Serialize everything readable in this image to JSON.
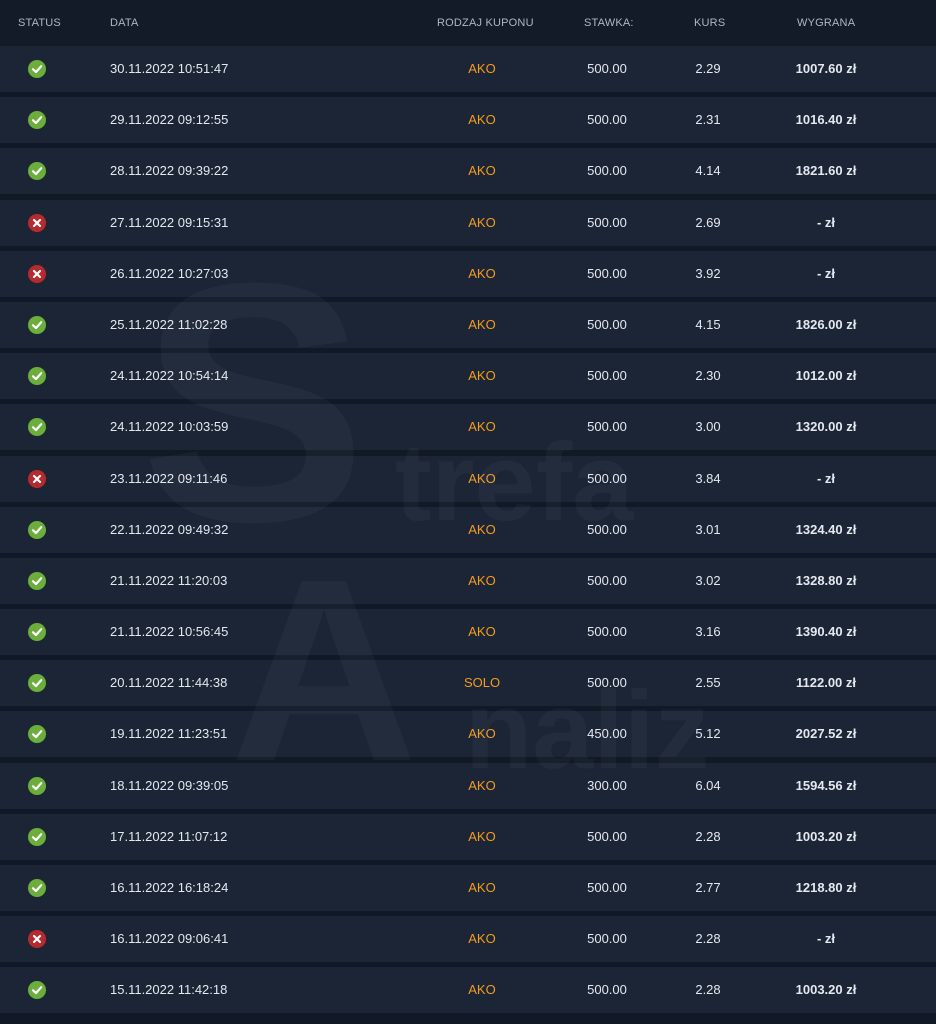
{
  "header": {
    "status": "STATUS",
    "date": "DATA",
    "coupon_type": "RODZAJ KUPONU",
    "stake": "STAWKA:",
    "odds": "KURS",
    "win": "WYGRANA"
  },
  "colors": {
    "won": "#6cae3b",
    "lost": "#b52a2e",
    "coupon_type": "#f59b1d",
    "row_bg": "#1b2536",
    "page_bg": "#111826"
  },
  "rows": [
    {
      "status": "won",
      "status_icon": "check-circle-icon",
      "date": "30.11.2022 10:51:47",
      "type": "AKO",
      "stake": "500.00",
      "odds": "2.29",
      "win": "1007.60 zł"
    },
    {
      "status": "won",
      "status_icon": "check-circle-icon",
      "date": "29.11.2022 09:12:55",
      "type": "AKO",
      "stake": "500.00",
      "odds": "2.31",
      "win": "1016.40 zł"
    },
    {
      "status": "won",
      "status_icon": "check-circle-icon",
      "date": "28.11.2022 09:39:22",
      "type": "AKO",
      "stake": "500.00",
      "odds": "4.14",
      "win": "1821.60 zł"
    },
    {
      "status": "lost",
      "status_icon": "x-circle-icon",
      "date": "27.11.2022 09:15:31",
      "type": "AKO",
      "stake": "500.00",
      "odds": "2.69",
      "win": "- zł"
    },
    {
      "status": "lost",
      "status_icon": "x-circle-icon",
      "date": "26.11.2022 10:27:03",
      "type": "AKO",
      "stake": "500.00",
      "odds": "3.92",
      "win": "- zł"
    },
    {
      "status": "won",
      "status_icon": "check-circle-icon",
      "date": "25.11.2022 11:02:28",
      "type": "AKO",
      "stake": "500.00",
      "odds": "4.15",
      "win": "1826.00 zł"
    },
    {
      "status": "won",
      "status_icon": "check-circle-icon",
      "date": "24.11.2022 10:54:14",
      "type": "AKO",
      "stake": "500.00",
      "odds": "2.30",
      "win": "1012.00 zł"
    },
    {
      "status": "won",
      "status_icon": "check-circle-icon",
      "date": "24.11.2022 10:03:59",
      "type": "AKO",
      "stake": "500.00",
      "odds": "3.00",
      "win": "1320.00 zł"
    },
    {
      "status": "lost",
      "status_icon": "x-circle-icon",
      "date": "23.11.2022 09:11:46",
      "type": "AKO",
      "stake": "500.00",
      "odds": "3.84",
      "win": "- zł"
    },
    {
      "status": "won",
      "status_icon": "check-circle-icon",
      "date": "22.11.2022 09:49:32",
      "type": "AKO",
      "stake": "500.00",
      "odds": "3.01",
      "win": "1324.40 zł"
    },
    {
      "status": "won",
      "status_icon": "check-circle-icon",
      "date": "21.11.2022 11:20:03",
      "type": "AKO",
      "stake": "500.00",
      "odds": "3.02",
      "win": "1328.80 zł"
    },
    {
      "status": "won",
      "status_icon": "check-circle-icon",
      "date": "21.11.2022 10:56:45",
      "type": "AKO",
      "stake": "500.00",
      "odds": "3.16",
      "win": "1390.40 zł"
    },
    {
      "status": "won",
      "status_icon": "check-circle-icon",
      "date": "20.11.2022 11:44:38",
      "type": "SOLO",
      "stake": "500.00",
      "odds": "2.55",
      "win": "1122.00 zł"
    },
    {
      "status": "won",
      "status_icon": "check-circle-icon",
      "date": "19.11.2022 11:23:51",
      "type": "AKO",
      "stake": "450.00",
      "odds": "5.12",
      "win": "2027.52 zł"
    },
    {
      "status": "won",
      "status_icon": "check-circle-icon",
      "date": "18.11.2022 09:39:05",
      "type": "AKO",
      "stake": "300.00",
      "odds": "6.04",
      "win": "1594.56 zł"
    },
    {
      "status": "won",
      "status_icon": "check-circle-icon",
      "date": "17.11.2022 11:07:12",
      "type": "AKO",
      "stake": "500.00",
      "odds": "2.28",
      "win": "1003.20 zł"
    },
    {
      "status": "won",
      "status_icon": "check-circle-icon",
      "date": "16.11.2022 16:18:24",
      "type": "AKO",
      "stake": "500.00",
      "odds": "2.77",
      "win": "1218.80 zł"
    },
    {
      "status": "lost",
      "status_icon": "x-circle-icon",
      "date": "16.11.2022 09:06:41",
      "type": "AKO",
      "stake": "500.00",
      "odds": "2.28",
      "win": "- zł"
    },
    {
      "status": "won",
      "status_icon": "check-circle-icon",
      "date": "15.11.2022 11:42:18",
      "type": "AKO",
      "stake": "500.00",
      "odds": "2.28",
      "win": "1003.20 zł"
    }
  ],
  "watermark": {
    "text_1": "trefa",
    "text_2": "naliz",
    "letter_1": "S",
    "letter_2": "A"
  }
}
